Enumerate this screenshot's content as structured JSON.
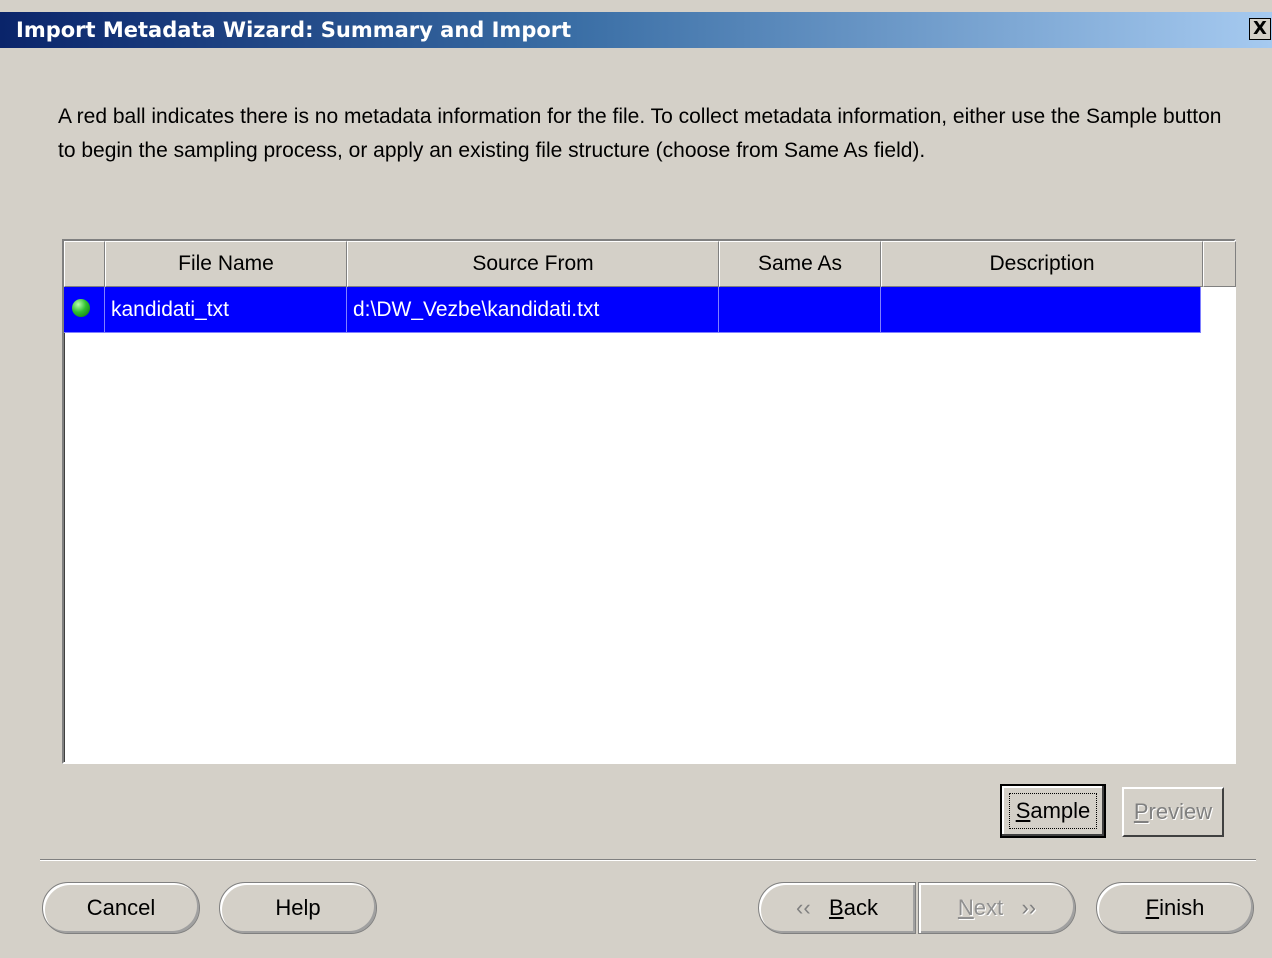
{
  "window": {
    "title": "Import Metadata Wizard: Summary and Import",
    "close_label": "X"
  },
  "instructions": "A red ball indicates there is no metadata information for the file. To collect metadata information, either use the Sample button to begin the sampling process, or apply an existing file structure (choose from Same As field).",
  "table": {
    "columns": [
      "",
      "File Name",
      "Source From",
      "Same As",
      "Description"
    ],
    "rows": [
      {
        "status_icon": "green-ball-icon",
        "file_name": "kandidati_txt",
        "source_from": "d:\\DW_Vezbe\\kandidati.txt",
        "same_as": "",
        "description": ""
      }
    ]
  },
  "buttons": {
    "sample": {
      "prefix": "",
      "mnemonic": "S",
      "rest": "ample"
    },
    "preview": {
      "prefix": "",
      "mnemonic": "P",
      "rest": "review"
    },
    "cancel": "Cancel",
    "help": "Help",
    "back": {
      "prefix": "",
      "mnemonic": "B",
      "rest": "ack"
    },
    "next": {
      "prefix": "",
      "mnemonic": "N",
      "rest": "ext"
    },
    "finish": {
      "prefix": "",
      "mnemonic": "F",
      "rest": "inish"
    }
  },
  "colors": {
    "selection": "#0000ff",
    "titlebar_start": "#0a246a",
    "titlebar_end": "#a6caf0"
  }
}
